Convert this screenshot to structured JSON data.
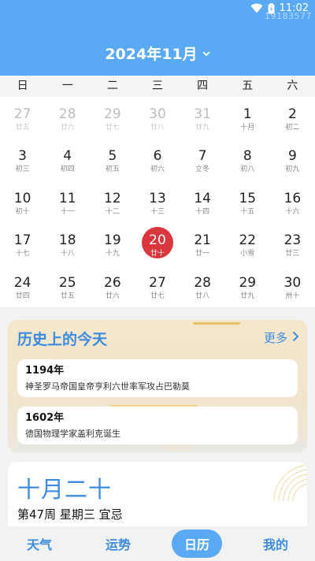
{
  "status_bar": {
    "time": "11:02",
    "watermark": "19183577"
  },
  "header": {
    "month_title": "2024年11月"
  },
  "weekdays": [
    "日",
    "一",
    "二",
    "三",
    "四",
    "五",
    "六"
  ],
  "calendar": {
    "rows": [
      [
        {
          "day": "27",
          "lunar": "廿五",
          "other": true
        },
        {
          "day": "28",
          "lunar": "廿六",
          "other": true
        },
        {
          "day": "29",
          "lunar": "廿七",
          "other": true
        },
        {
          "day": "30",
          "lunar": "廿八",
          "other": true
        },
        {
          "day": "31",
          "lunar": "廿九",
          "other": true
        },
        {
          "day": "1",
          "lunar": "十月"
        },
        {
          "day": "2",
          "lunar": "初二"
        }
      ],
      [
        {
          "day": "3",
          "lunar": "初三"
        },
        {
          "day": "4",
          "lunar": "初四"
        },
        {
          "day": "5",
          "lunar": "初五"
        },
        {
          "day": "6",
          "lunar": "初六"
        },
        {
          "day": "7",
          "lunar": "立冬"
        },
        {
          "day": "8",
          "lunar": "初八"
        },
        {
          "day": "9",
          "lunar": "初九"
        }
      ],
      [
        {
          "day": "10",
          "lunar": "初十"
        },
        {
          "day": "11",
          "lunar": "十一"
        },
        {
          "day": "12",
          "lunar": "十二"
        },
        {
          "day": "13",
          "lunar": "十三"
        },
        {
          "day": "14",
          "lunar": "十四"
        },
        {
          "day": "15",
          "lunar": "十五"
        },
        {
          "day": "16",
          "lunar": "十六"
        }
      ],
      [
        {
          "day": "17",
          "lunar": "十七"
        },
        {
          "day": "18",
          "lunar": "十八"
        },
        {
          "day": "19",
          "lunar": "十九"
        },
        {
          "day": "20",
          "lunar": "廿十",
          "today": true
        },
        {
          "day": "21",
          "lunar": "廿一"
        },
        {
          "day": "22",
          "lunar": "小雪"
        },
        {
          "day": "23",
          "lunar": "廿三"
        }
      ],
      [
        {
          "day": "24",
          "lunar": "廿四"
        },
        {
          "day": "25",
          "lunar": "廿五"
        },
        {
          "day": "26",
          "lunar": "廿六"
        },
        {
          "day": "27",
          "lunar": "廿七"
        },
        {
          "day": "28",
          "lunar": "廿八"
        },
        {
          "day": "29",
          "lunar": "廿九"
        },
        {
          "day": "30",
          "lunar": "卅十"
        }
      ]
    ]
  },
  "history": {
    "title": "历史上的今天",
    "more_label": "更多",
    "events": [
      {
        "year": "1194年",
        "desc": "神圣罗马帝国皇帝亨利六世率军攻占巴勒莫"
      },
      {
        "year": "1602年",
        "desc": "德国物理学家盖利克诞生"
      }
    ]
  },
  "lunar_card": {
    "date": "十月二十",
    "info": "第47周 星期三 宜忌"
  },
  "bottom_nav": [
    {
      "label": "天气"
    },
    {
      "label": "运势"
    },
    {
      "label": "日历",
      "active": true
    },
    {
      "label": "我的"
    }
  ],
  "colors": {
    "header": "#5aa9f5",
    "accent": "#3b8ce0",
    "today": "#d9363e"
  },
  "icons": [
    "wifi-icon",
    "battery-icon",
    "chevron-down-icon",
    "chevron-right-icon"
  ]
}
